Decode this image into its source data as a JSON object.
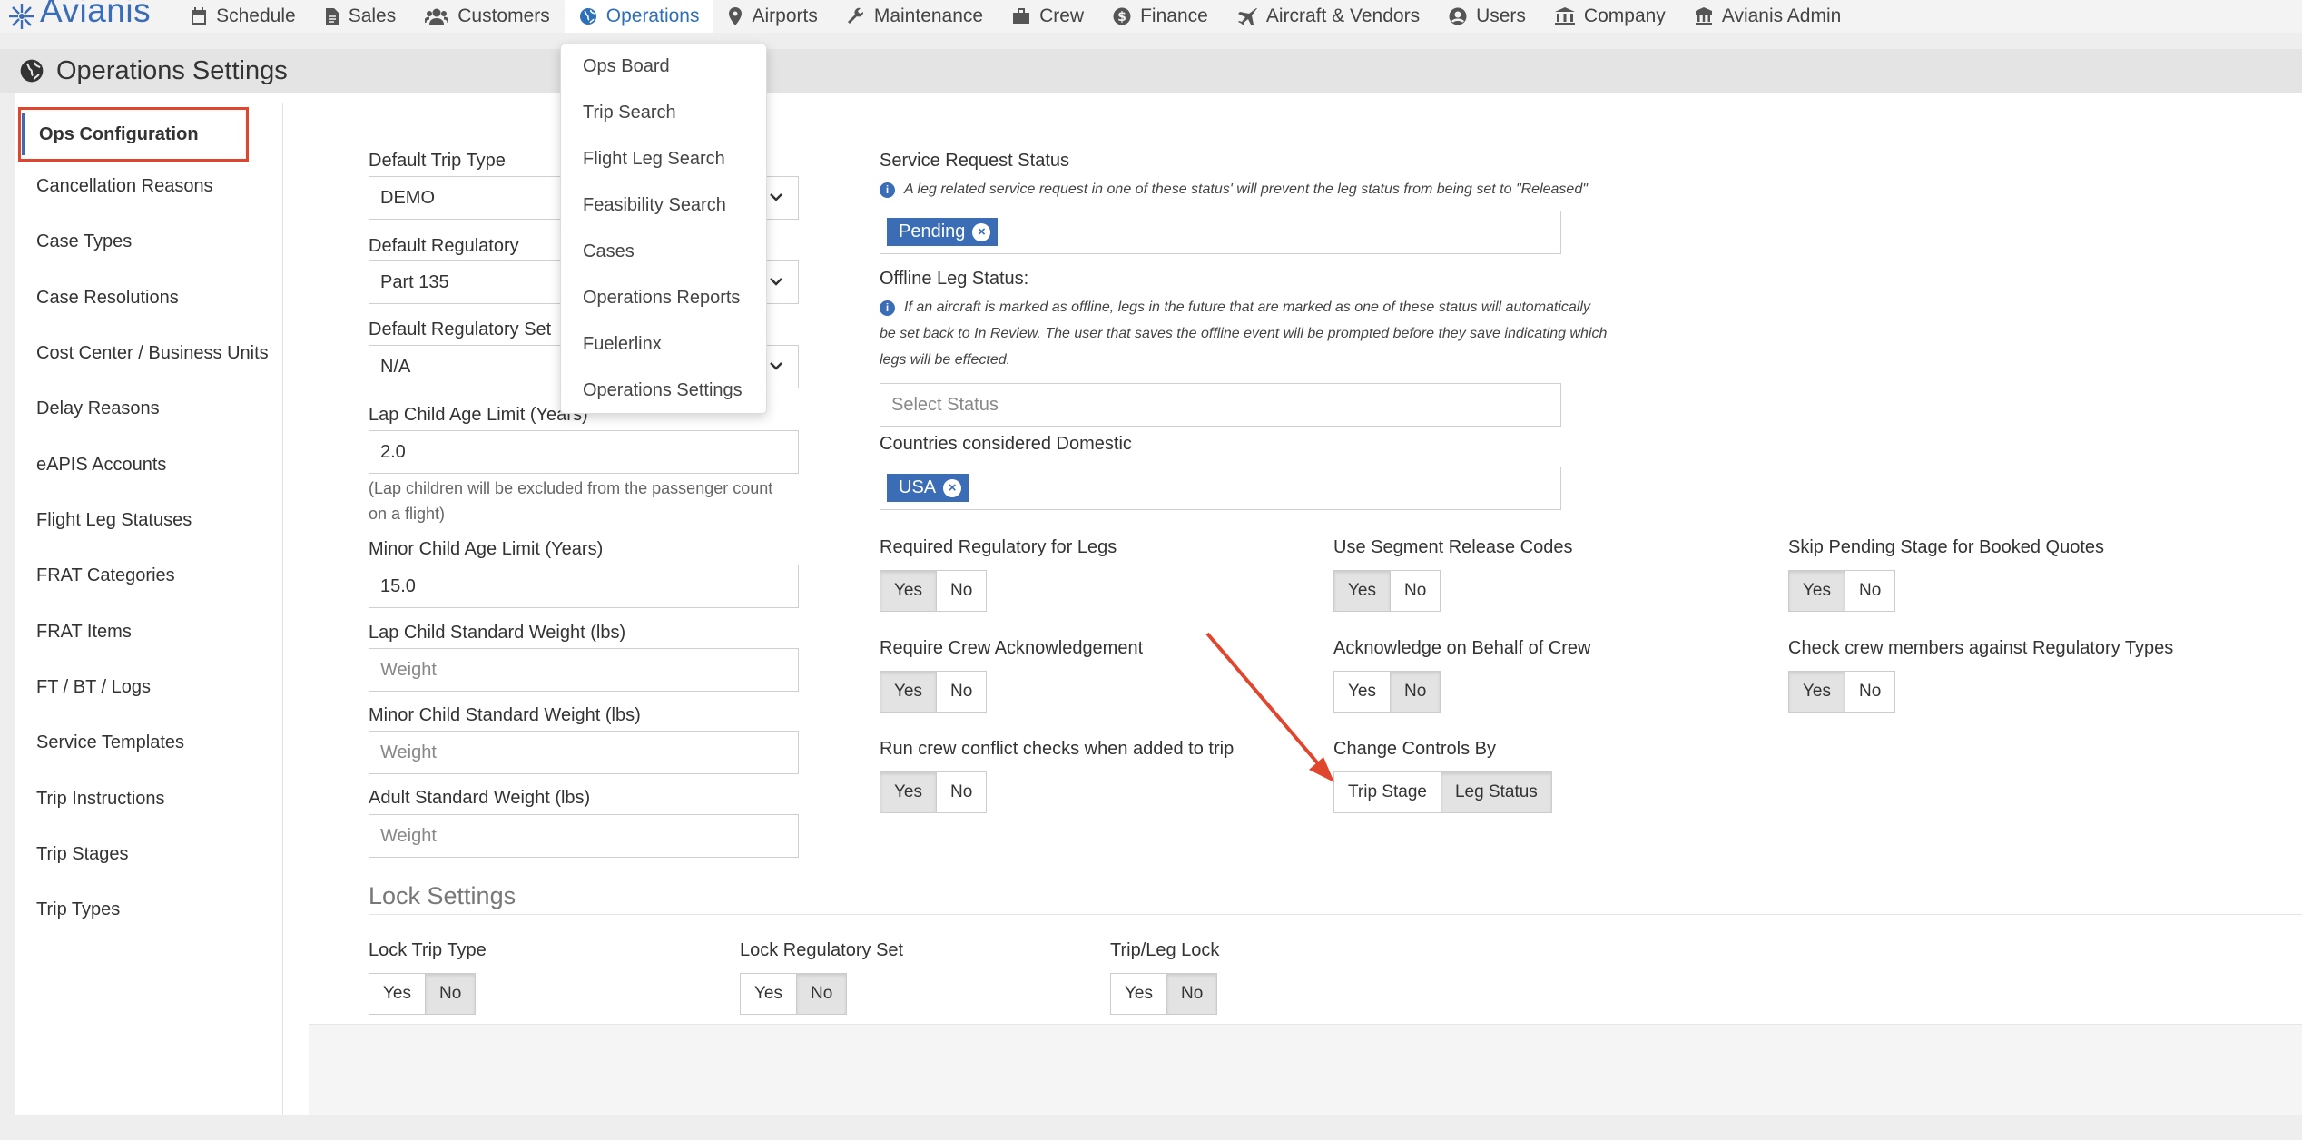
{
  "app": {
    "brand": "Avianis"
  },
  "nav": {
    "items": [
      {
        "label": "Schedule",
        "icon": "calendar-icon"
      },
      {
        "label": "Sales",
        "icon": "file-icon"
      },
      {
        "label": "Customers",
        "icon": "users-icon"
      },
      {
        "label": "Operations",
        "icon": "globe-icon",
        "active": true
      },
      {
        "label": "Airports",
        "icon": "map-pin-icon"
      },
      {
        "label": "Maintenance",
        "icon": "wrench-icon"
      },
      {
        "label": "Crew",
        "icon": "briefcase-icon"
      },
      {
        "label": "Finance",
        "icon": "dollar-icon"
      },
      {
        "label": "Aircraft & Vendors",
        "icon": "plane-icon"
      },
      {
        "label": "Users",
        "icon": "user-circle-icon"
      },
      {
        "label": "Company",
        "icon": "bank-icon"
      },
      {
        "label": "Avianis Admin",
        "icon": "admin-icon"
      }
    ]
  },
  "dropdown": {
    "items": [
      "Ops Board",
      "Trip Search",
      "Flight Leg Search",
      "Feasibility Search",
      "Cases",
      "Operations Reports",
      "Fuelerlinx",
      "Operations Settings"
    ]
  },
  "page": {
    "title": "Operations Settings"
  },
  "sidebar": {
    "items": [
      {
        "label": "Ops Configuration",
        "active": true
      },
      {
        "label": "Cancellation Reasons"
      },
      {
        "label": "Case Types"
      },
      {
        "label": "Case Resolutions"
      },
      {
        "label": "Cost Center / Business Units"
      },
      {
        "label": "Delay Reasons"
      },
      {
        "label": "eAPIS Accounts"
      },
      {
        "label": "Flight Leg Statuses"
      },
      {
        "label": "FRAT Categories"
      },
      {
        "label": "FRAT Items"
      },
      {
        "label": "FT / BT / Logs"
      },
      {
        "label": "Service Templates"
      },
      {
        "label": "Trip Instructions"
      },
      {
        "label": "Trip Stages"
      },
      {
        "label": "Trip Types"
      }
    ]
  },
  "form": {
    "default_trip_type": {
      "label": "Default Trip Type",
      "value": "DEMO"
    },
    "default_regulatory": {
      "label": "Default Regulatory",
      "value": "Part 135"
    },
    "default_regulatory_set": {
      "label": "Default Regulatory Set",
      "value": "N/A"
    },
    "lap_child_age": {
      "label": "Lap Child Age Limit (Years)",
      "value": "2.0",
      "help_1": "(Lap children will be excluded from the passenger count",
      "help_2": "on a flight)"
    },
    "minor_child_age": {
      "label": "Minor Child Age Limit (Years)",
      "value": "15.0"
    },
    "lap_child_weight": {
      "label": "Lap Child Standard Weight (lbs)",
      "placeholder": "Weight"
    },
    "minor_child_weight": {
      "label": "Minor Child Standard Weight (lbs)",
      "placeholder": "Weight"
    },
    "adult_weight": {
      "label": "Adult Standard Weight (lbs)",
      "placeholder": "Weight"
    },
    "service_request_status": {
      "label": "Service Request Status",
      "note": "A leg related service request in one of these status' will prevent the leg status from being set to \"Released\"",
      "tags": [
        "Pending"
      ]
    },
    "offline_leg_status": {
      "label": "Offline Leg Status:",
      "note_1": "If an aircraft is marked as offline, legs in the future that are marked as one of these status will automatically",
      "note_2": "be set back to In Review. The user that saves the offline event will be prompted before they save indicating which",
      "note_3": "legs will be effected.",
      "placeholder": "Select Status"
    },
    "domestic_countries": {
      "label": "Countries considered Domestic",
      "tags": [
        "USA"
      ]
    }
  },
  "toggles": [
    {
      "label": "Required Regulatory for Legs",
      "options": [
        "Yes",
        "No"
      ],
      "selected": "Yes"
    },
    {
      "label": "Use Segment Release Codes",
      "options": [
        "Yes",
        "No"
      ],
      "selected": "Yes"
    },
    {
      "label": "Skip Pending Stage for Booked Quotes",
      "options": [
        "Yes",
        "No"
      ],
      "selected": "Yes"
    },
    {
      "label": "Require Crew Acknowledgement",
      "options": [
        "Yes",
        "No"
      ],
      "selected": "Yes"
    },
    {
      "label": "Acknowledge on Behalf of Crew",
      "options": [
        "Yes",
        "No"
      ],
      "selected": "No"
    },
    {
      "label": "Check crew members against Regulatory Types",
      "options": [
        "Yes",
        "No"
      ],
      "selected": "Yes"
    },
    {
      "label": "Run crew conflict checks when added to trip",
      "options": [
        "Yes",
        "No"
      ],
      "selected": "Yes"
    },
    {
      "label": "Change Controls By",
      "options": [
        "Trip Stage",
        "Leg Status"
      ],
      "selected": "Leg Status"
    }
  ],
  "lock_settings": {
    "title": "Lock Settings",
    "items": [
      {
        "label": "Lock Trip Type",
        "options": [
          "Yes",
          "No"
        ],
        "selected": "No"
      },
      {
        "label": "Lock Regulatory Set",
        "options": [
          "Yes",
          "No"
        ],
        "selected": "No"
      },
      {
        "label": "Trip/Leg Lock",
        "options": [
          "Yes",
          "No"
        ],
        "selected": "No"
      }
    ]
  },
  "colors": {
    "accent": "#3a6db5",
    "highlight": "#e0452e"
  }
}
